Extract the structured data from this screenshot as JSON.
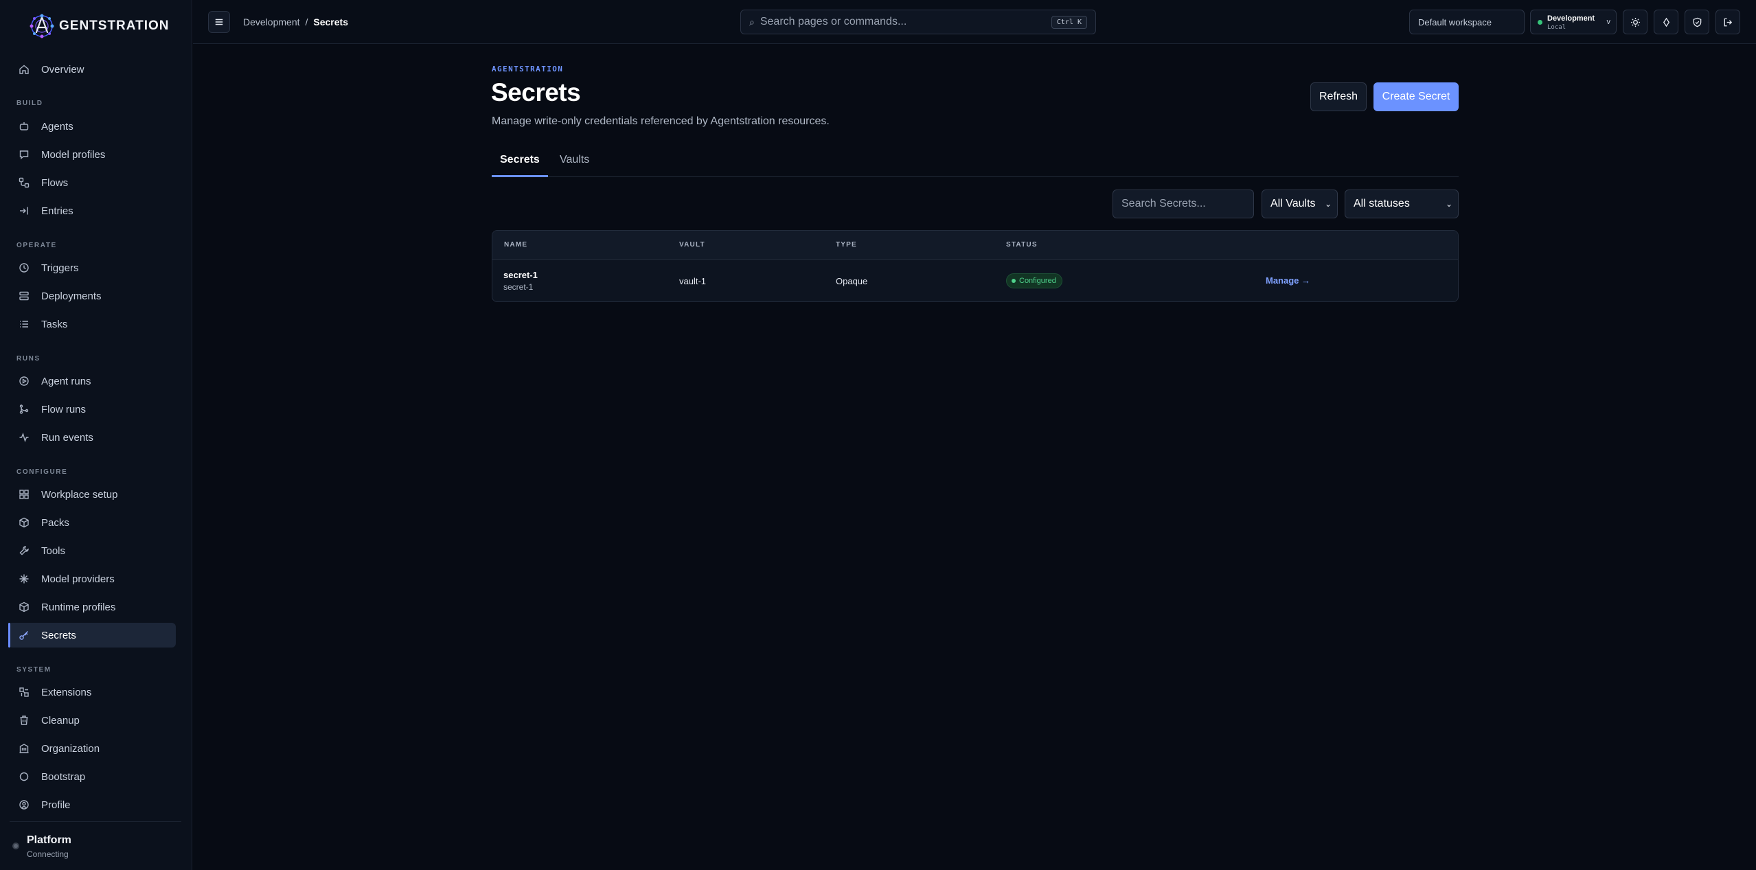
{
  "app": {
    "name": "GENTSTRATION"
  },
  "sidebar": {
    "top_item": {
      "label": "Overview",
      "icon": "home-icon"
    },
    "sections": [
      {
        "title": "BUILD",
        "items": [
          {
            "label": "Agents",
            "icon": "robot-icon"
          },
          {
            "label": "Model profiles",
            "icon": "chat-icon"
          },
          {
            "label": "Flows",
            "icon": "workflow-icon"
          },
          {
            "label": "Entries",
            "icon": "sign-in-icon"
          }
        ]
      },
      {
        "title": "OPERATE",
        "items": [
          {
            "label": "Triggers",
            "icon": "clock-icon"
          },
          {
            "label": "Deployments",
            "icon": "server-icon"
          },
          {
            "label": "Tasks",
            "icon": "list-icon"
          }
        ]
      },
      {
        "title": "RUNS",
        "items": [
          {
            "label": "Agent runs",
            "icon": "play-circle-icon"
          },
          {
            "label": "Flow runs",
            "icon": "branch-icon"
          },
          {
            "label": "Run events",
            "icon": "activity-icon"
          }
        ]
      },
      {
        "title": "CONFIGURE",
        "items": [
          {
            "label": "Workplace setup",
            "icon": "grid-icon"
          },
          {
            "label": "Packs",
            "icon": "package-icon"
          },
          {
            "label": "Tools",
            "icon": "wrench-icon"
          },
          {
            "label": "Model providers",
            "icon": "sparkle-icon"
          },
          {
            "label": "Runtime profiles",
            "icon": "cube-icon"
          },
          {
            "label": "Secrets",
            "icon": "key-icon",
            "active": true
          }
        ]
      },
      {
        "title": "SYSTEM",
        "items": [
          {
            "label": "Extensions",
            "icon": "puzzle-icon"
          },
          {
            "label": "Cleanup",
            "icon": "trash-icon"
          },
          {
            "label": "Organization",
            "icon": "building-icon"
          },
          {
            "label": "Bootstrap",
            "icon": "circle-icon"
          },
          {
            "label": "Profile",
            "icon": "user-circle-icon"
          }
        ]
      }
    ],
    "footer": {
      "title": "Platform",
      "subtitle": "Connecting"
    }
  },
  "topbar": {
    "breadcrumb": [
      "Development",
      "/",
      "Secrets"
    ],
    "search": {
      "placeholder": "Search pages or commands...",
      "shortcut": "Ctrl K"
    },
    "workspace": "Default workspace",
    "environment": {
      "name": "Development",
      "sub": "Local",
      "status_color": "#36c47a"
    },
    "icons": [
      "sun-icon",
      "diamond-icon",
      "shield-check-icon",
      "logout-icon"
    ]
  },
  "page": {
    "eyebrow": "AGENTSTRATION",
    "title": "Secrets",
    "description": "Manage write-only credentials referenced by Agentstration resources.",
    "actions": {
      "refresh": "Refresh",
      "create": "Create Secret"
    },
    "tabs": [
      {
        "label": "Secrets",
        "active": true
      },
      {
        "label": "Vaults",
        "active": false
      }
    ],
    "filters": {
      "search_placeholder": "Search Secrets...",
      "vault_selected": "All Vaults",
      "status_selected": "All statuses"
    },
    "table": {
      "columns": [
        "NAME",
        "VAULT",
        "TYPE",
        "STATUS"
      ],
      "rows": [
        {
          "name": "secret-1",
          "name_sub": "secret-1",
          "vault": "vault-1",
          "type": "Opaque",
          "status": "Configured",
          "action": "Manage →"
        }
      ]
    }
  },
  "colors": {
    "accent": "#6b92ff",
    "success": "#4fd18b",
    "background": "#070b14",
    "sidebar": "#0b111c"
  }
}
